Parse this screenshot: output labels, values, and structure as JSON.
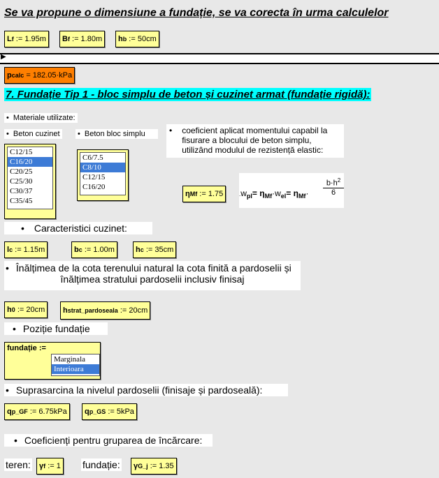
{
  "heading_main": "Se va propune o dimensiune a fundație, se va corecta în urma calculelor",
  "dims": {
    "lf_label": "L",
    "lf_sub": "f",
    "lf_val": ":= 1.95m",
    "bf_label": "B",
    "bf_sub": "f",
    "bf_val": ":= 1.80m",
    "hb_label": "h",
    "hb_sub": "b",
    "hb_val": ":= 50cm"
  },
  "pcalc": {
    "label": "p",
    "sub": "calc",
    "val": "= 182.05·kPa",
    "color": "#ff7f00"
  },
  "section7": {
    "title": "7. Fundație Tip 1 - bloc simplu de beton și cuzinet armat (fundație rigidă):",
    "bg": "#00ffff"
  },
  "materiale_label": "Materiale utilizate:",
  "beton_cuzinet_label": "Beton cuzinet",
  "beton_bloc_label": "Beton bloc simplu",
  "coef_text": "coeficient aplicat momentului capabil la fisurare a blocului de beton simplu, utilizând modulul de rezistență elastic:",
  "list_cuzinet": {
    "options": [
      "C12/15",
      "C16/20",
      "C20/25",
      "C25/30",
      "C30/37",
      "C35/45"
    ],
    "selected": "C16/20"
  },
  "list_bloc": {
    "options": [
      "C6/7.5",
      "C8/10",
      "C12/15",
      "C16/20"
    ],
    "selected": "C8/10"
  },
  "eta": {
    "label": "η",
    "sub": "Mf",
    "val": ":= 1.75"
  },
  "formula": {
    "w": "w",
    "pl": "pl",
    "eq1": "= η",
    "mf": "Mf",
    "dot": "·w",
    "el": "el",
    "eq2": "= η",
    "mf2": "Mf",
    "num": "b·h",
    "exp": "2",
    "den": "6"
  },
  "caract_label": "Caracteristici cuzinet:",
  "cuz": {
    "lc_label": "l",
    "lc_sub": "c",
    "lc_val": ":= 1.15m",
    "bc_label": "b",
    "bc_sub": "c",
    "bc_val": ":= 1.00m",
    "hc_label": "h",
    "hc_sub": "c",
    "hc_val": ":= 35cm"
  },
  "inaltime_text_1": "Înălțimea de la cota terenului natural la cota finită a pardoselii și",
  "inaltime_text_2": "înălțimea stratului pardoselii inclusiv finisaj",
  "h0": {
    "label": "h",
    "sub": "0",
    "val": ":= 20cm"
  },
  "hstrat": {
    "label": "h",
    "sub": "strat_pardoseala",
    "val": ":= 20cm"
  },
  "pozitie_label": "Poziție fundație",
  "fundatie_label": "fundație :=",
  "list_fundatie": {
    "options": [
      "Marginala",
      "Interioara"
    ],
    "selected": "Interioara"
  },
  "suprasarcina_label": "Suprasarcina la nivelul pardoselii (finisaje și pardoseală):",
  "qgf": {
    "label": "q",
    "sub": "p_GF",
    "val": ":= 6.75kPa"
  },
  "qgs": {
    "label": "q",
    "sub": "p_GS",
    "val": ":= 5kPa"
  },
  "coef_grupare_label": "Coeficienți pentru gruparea de încărcare:",
  "teren_label": "teren:",
  "gf": {
    "label": "γ",
    "sub": "f",
    "val": ":= 1"
  },
  "fundatie2_label": "fundație:",
  "gGj": {
    "label": "γ",
    "sub": "G_j",
    "val": ":= 1.35"
  }
}
